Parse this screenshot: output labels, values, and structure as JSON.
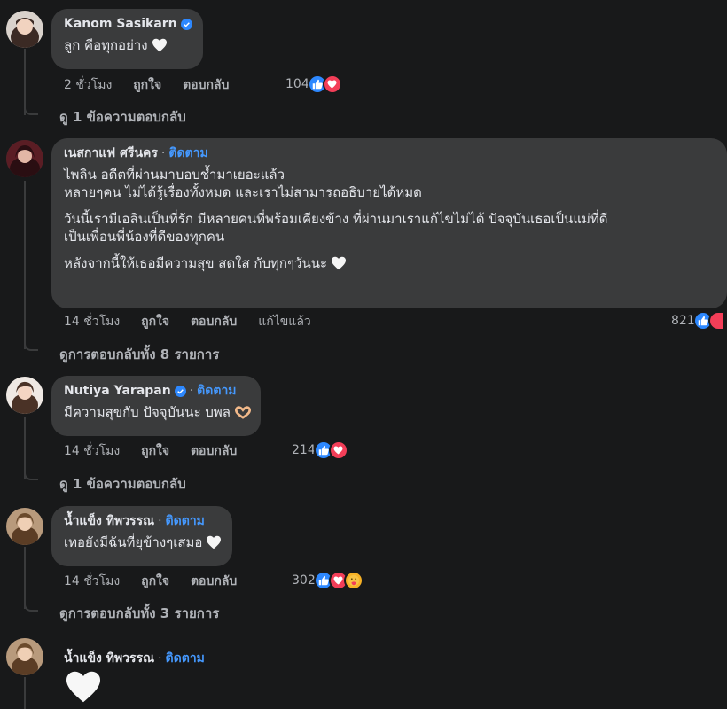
{
  "comments": [
    {
      "name": "Kanom Sasikarn",
      "verified": true,
      "follow": "",
      "lines": [
        "ลูก คือทุกอย่าง"
      ],
      "time": "2 ชั่วโมง",
      "like": "ถูกใจ",
      "reply": "ตอบกลับ",
      "edited": "",
      "reaction_count": "104",
      "reactions": [
        "like",
        "love"
      ],
      "view_replies": "ดู 1 ข้อความตอบกลับ"
    },
    {
      "name": "เนสกาแฟ ศรีนคร",
      "verified": false,
      "follow": "ติดตาม",
      "lines": [
        "ไพลิน อดีตที่ผ่านมาบอบช้ำมาเยอะแล้ว",
        "หลายๆคน ไม่ได้รู้เรื่องทั้งหมด และเราไม่สามารถอธิบายได้หมด",
        "วันนี้เรามีเอลินเป็นที่รัก มีหลายคนที่พร้อมเคียงข้าง ที่ผ่านมาเราแก้ไขไม่ได้ ปัจจุบันเธอเป็นแม่ที่ดี",
        "เป็นเพื่อนพี่น้องที่ดีของทุกคน",
        "หลังจากนี้ให้เธอมีความสุข สดใส กับทุกๆวันนะ"
      ],
      "time": "14 ชั่วโมง",
      "like": "ถูกใจ",
      "reply": "ตอบกลับ",
      "edited": "แก้ไขแล้ว",
      "reaction_count": "821",
      "reactions": [
        "like",
        "love"
      ],
      "view_replies": "ดูการตอบกลับทั้ง 8 รายการ"
    },
    {
      "name": "Nutiya Yarapan",
      "verified": true,
      "follow": "ติดตาม",
      "lines": [
        "มีความสุขกับ ปัจจุบันนะ บพล"
      ],
      "time": "14 ชั่วโมง",
      "like": "ถูกใจ",
      "reply": "ตอบกลับ",
      "edited": "",
      "reaction_count": "214",
      "reactions": [
        "like",
        "love"
      ],
      "view_replies": "ดู 1 ข้อความตอบกลับ"
    },
    {
      "name": "น้ำแข็ง ทิพวรรณ",
      "verified": false,
      "follow": "ติดตาม",
      "lines": [
        "เทอยังมีฉันที่ยุข้างๆเสมอ"
      ],
      "time": "14 ชั่วโมง",
      "like": "ถูกใจ",
      "reply": "ตอบกลับ",
      "edited": "",
      "reaction_count": "302",
      "reactions": [
        "like",
        "love",
        "care"
      ],
      "view_replies": "ดูการตอบกลับทั้ง 3 รายการ"
    },
    {
      "name": "น้ำแข็ง ทิพวรรณ",
      "verified": false,
      "follow": "ติดตาม",
      "lines": [],
      "sticker": "white-heart",
      "time": "",
      "like": "",
      "reply": "",
      "edited": "",
      "reaction_count": "",
      "reactions": [],
      "view_replies": ""
    }
  ],
  "separator": "·",
  "colors": {
    "background": "#18191a",
    "bubble": "#3a3b3c",
    "text": "#e4e6eb",
    "secondary": "#b0b3b8",
    "link": "#4599ff",
    "like": "#2d88ff",
    "love": "#f33e58"
  }
}
